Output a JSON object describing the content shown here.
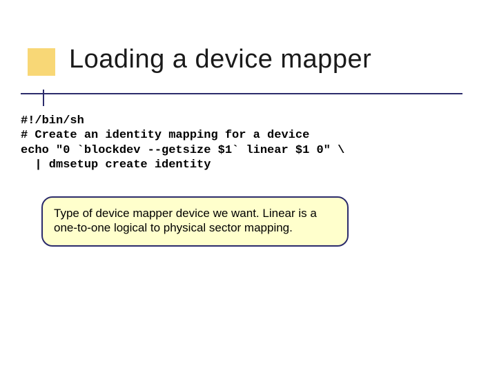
{
  "title": "Loading a device mapper",
  "code": {
    "line1": "#!/bin/sh",
    "line2": "# Create an identity mapping for a device",
    "line3": "echo \"0 `blockdev --getsize $1` linear $1 0\" \\",
    "line4": "  | dmsetup create identity"
  },
  "callout": "Type of device mapper device we want.  Linear is a one-to-one logical to physical sector mapping."
}
